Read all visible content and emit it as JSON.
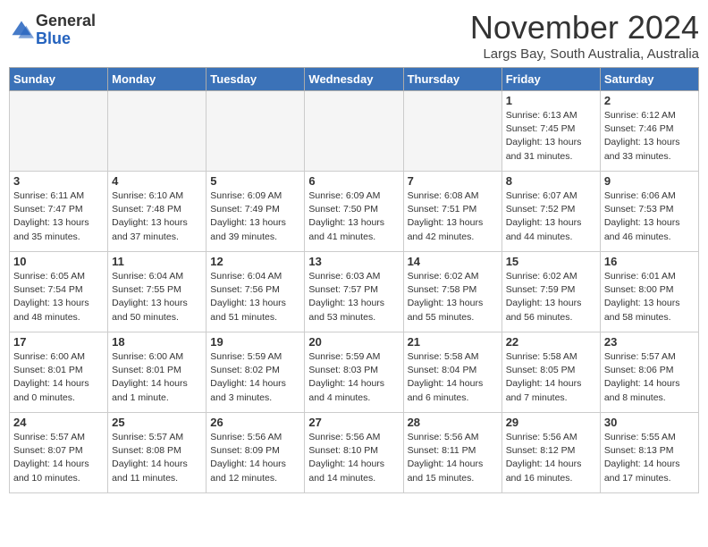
{
  "header": {
    "logo_general": "General",
    "logo_blue": "Blue",
    "month": "November 2024",
    "location": "Largs Bay, South Australia, Australia"
  },
  "weekdays": [
    "Sunday",
    "Monday",
    "Tuesday",
    "Wednesday",
    "Thursday",
    "Friday",
    "Saturday"
  ],
  "weeks": [
    [
      {
        "day": "",
        "info": ""
      },
      {
        "day": "",
        "info": ""
      },
      {
        "day": "",
        "info": ""
      },
      {
        "day": "",
        "info": ""
      },
      {
        "day": "",
        "info": ""
      },
      {
        "day": "1",
        "info": "Sunrise: 6:13 AM\nSunset: 7:45 PM\nDaylight: 13 hours\nand 31 minutes."
      },
      {
        "day": "2",
        "info": "Sunrise: 6:12 AM\nSunset: 7:46 PM\nDaylight: 13 hours\nand 33 minutes."
      }
    ],
    [
      {
        "day": "3",
        "info": "Sunrise: 6:11 AM\nSunset: 7:47 PM\nDaylight: 13 hours\nand 35 minutes."
      },
      {
        "day": "4",
        "info": "Sunrise: 6:10 AM\nSunset: 7:48 PM\nDaylight: 13 hours\nand 37 minutes."
      },
      {
        "day": "5",
        "info": "Sunrise: 6:09 AM\nSunset: 7:49 PM\nDaylight: 13 hours\nand 39 minutes."
      },
      {
        "day": "6",
        "info": "Sunrise: 6:09 AM\nSunset: 7:50 PM\nDaylight: 13 hours\nand 41 minutes."
      },
      {
        "day": "7",
        "info": "Sunrise: 6:08 AM\nSunset: 7:51 PM\nDaylight: 13 hours\nand 42 minutes."
      },
      {
        "day": "8",
        "info": "Sunrise: 6:07 AM\nSunset: 7:52 PM\nDaylight: 13 hours\nand 44 minutes."
      },
      {
        "day": "9",
        "info": "Sunrise: 6:06 AM\nSunset: 7:53 PM\nDaylight: 13 hours\nand 46 minutes."
      }
    ],
    [
      {
        "day": "10",
        "info": "Sunrise: 6:05 AM\nSunset: 7:54 PM\nDaylight: 13 hours\nand 48 minutes."
      },
      {
        "day": "11",
        "info": "Sunrise: 6:04 AM\nSunset: 7:55 PM\nDaylight: 13 hours\nand 50 minutes."
      },
      {
        "day": "12",
        "info": "Sunrise: 6:04 AM\nSunset: 7:56 PM\nDaylight: 13 hours\nand 51 minutes."
      },
      {
        "day": "13",
        "info": "Sunrise: 6:03 AM\nSunset: 7:57 PM\nDaylight: 13 hours\nand 53 minutes."
      },
      {
        "day": "14",
        "info": "Sunrise: 6:02 AM\nSunset: 7:58 PM\nDaylight: 13 hours\nand 55 minutes."
      },
      {
        "day": "15",
        "info": "Sunrise: 6:02 AM\nSunset: 7:59 PM\nDaylight: 13 hours\nand 56 minutes."
      },
      {
        "day": "16",
        "info": "Sunrise: 6:01 AM\nSunset: 8:00 PM\nDaylight: 13 hours\nand 58 minutes."
      }
    ],
    [
      {
        "day": "17",
        "info": "Sunrise: 6:00 AM\nSunset: 8:01 PM\nDaylight: 14 hours\nand 0 minutes."
      },
      {
        "day": "18",
        "info": "Sunrise: 6:00 AM\nSunset: 8:01 PM\nDaylight: 14 hours\nand 1 minute."
      },
      {
        "day": "19",
        "info": "Sunrise: 5:59 AM\nSunset: 8:02 PM\nDaylight: 14 hours\nand 3 minutes."
      },
      {
        "day": "20",
        "info": "Sunrise: 5:59 AM\nSunset: 8:03 PM\nDaylight: 14 hours\nand 4 minutes."
      },
      {
        "day": "21",
        "info": "Sunrise: 5:58 AM\nSunset: 8:04 PM\nDaylight: 14 hours\nand 6 minutes."
      },
      {
        "day": "22",
        "info": "Sunrise: 5:58 AM\nSunset: 8:05 PM\nDaylight: 14 hours\nand 7 minutes."
      },
      {
        "day": "23",
        "info": "Sunrise: 5:57 AM\nSunset: 8:06 PM\nDaylight: 14 hours\nand 8 minutes."
      }
    ],
    [
      {
        "day": "24",
        "info": "Sunrise: 5:57 AM\nSunset: 8:07 PM\nDaylight: 14 hours\nand 10 minutes."
      },
      {
        "day": "25",
        "info": "Sunrise: 5:57 AM\nSunset: 8:08 PM\nDaylight: 14 hours\nand 11 minutes."
      },
      {
        "day": "26",
        "info": "Sunrise: 5:56 AM\nSunset: 8:09 PM\nDaylight: 14 hours\nand 12 minutes."
      },
      {
        "day": "27",
        "info": "Sunrise: 5:56 AM\nSunset: 8:10 PM\nDaylight: 14 hours\nand 14 minutes."
      },
      {
        "day": "28",
        "info": "Sunrise: 5:56 AM\nSunset: 8:11 PM\nDaylight: 14 hours\nand 15 minutes."
      },
      {
        "day": "29",
        "info": "Sunrise: 5:56 AM\nSunset: 8:12 PM\nDaylight: 14 hours\nand 16 minutes."
      },
      {
        "day": "30",
        "info": "Sunrise: 5:55 AM\nSunset: 8:13 PM\nDaylight: 14 hours\nand 17 minutes."
      }
    ]
  ]
}
